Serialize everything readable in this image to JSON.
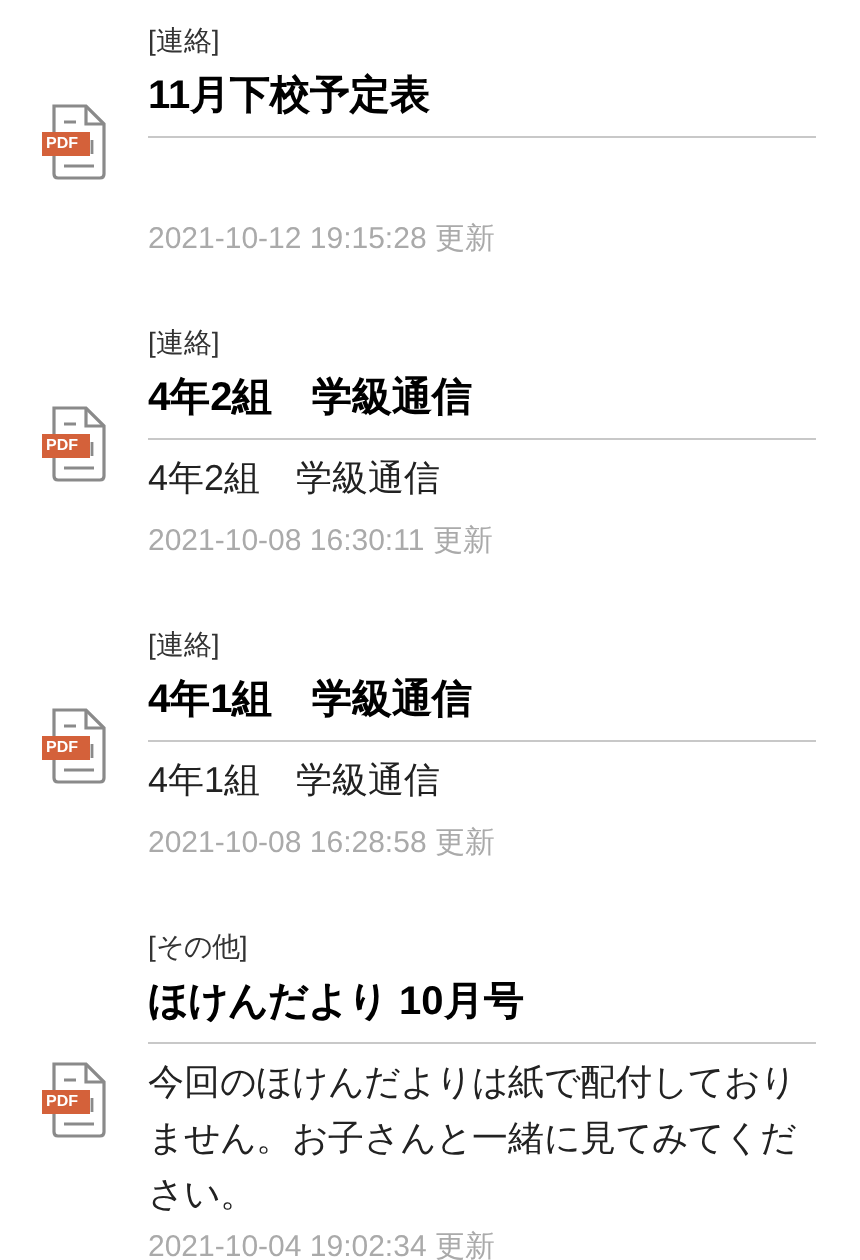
{
  "items": [
    {
      "file_type": "PDF",
      "category": "[連絡]",
      "title": "11月下校予定表",
      "updated": "2021-10-12 19:15:28 更新"
    },
    {
      "file_type": "PDF",
      "category": "[連絡]",
      "title": "4年2組　学級通信",
      "body": "4年2組　学級通信",
      "updated": "2021-10-08 16:30:11 更新"
    },
    {
      "file_type": "PDF",
      "category": "[連絡]",
      "title": "4年1組　学級通信",
      "body": "4年1組　学級通信",
      "updated": "2021-10-08 16:28:58 更新"
    },
    {
      "file_type": "PDF",
      "category": "[その他]",
      "title": "ほけんだより 10月号",
      "body": "今回のほけんだよりは紙で配付しておりません。お子さんと一緒に見てみてください。",
      "updated": "2021-10-04 19:02:34 更新"
    }
  ]
}
